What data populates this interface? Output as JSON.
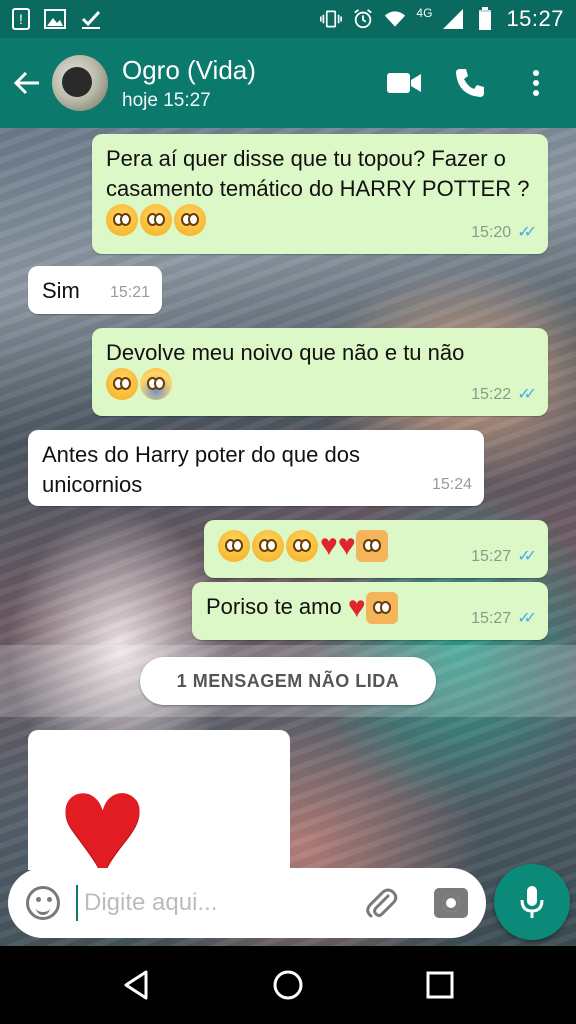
{
  "status_bar": {
    "time": "15:27",
    "network": "4G",
    "icons": [
      "alert-icon",
      "image-icon",
      "check-icon",
      "vibrate-icon",
      "alarm-icon",
      "wifi-icon",
      "signal-icon",
      "battery-icon"
    ]
  },
  "header": {
    "contact_name": "Ogro (Vida)",
    "last_seen": "hoje 15:27",
    "accent_color": "#0b7a6d"
  },
  "messages": [
    {
      "direction": "out",
      "text": "Pera aí quer disse que tu topou? Fazer o casamento temático do HARRY POTTER ?",
      "emojis": [
        "flushed",
        "flushed",
        "flushed"
      ],
      "time": "15:20",
      "status": "read"
    },
    {
      "direction": "in",
      "text": "Sim",
      "time": "15:21"
    },
    {
      "direction": "out",
      "text": "Devolve meu noivo que não e tu não",
      "emojis": [
        "flushed",
        "scream"
      ],
      "time": "15:22",
      "status": "read"
    },
    {
      "direction": "in",
      "text": "Antes do Harry poter do que dos unicornios",
      "time": "15:24"
    },
    {
      "direction": "out",
      "text": "",
      "emojis": [
        "smirk",
        "smirk",
        "smirk",
        "heart",
        "heart",
        "couple-kiss"
      ],
      "time": "15:27",
      "status": "read"
    },
    {
      "direction": "out",
      "text": "Poriso te amo",
      "emojis": [
        "heart",
        "couple-kiss"
      ],
      "time": "15:27",
      "status": "read"
    },
    {
      "direction": "in",
      "text": "",
      "emojis": [
        "big-heart"
      ],
      "time": ""
    }
  ],
  "unread_banner": "1 MENSAGEM NÃO LIDA",
  "composer": {
    "placeholder": "Digite aqui..."
  }
}
